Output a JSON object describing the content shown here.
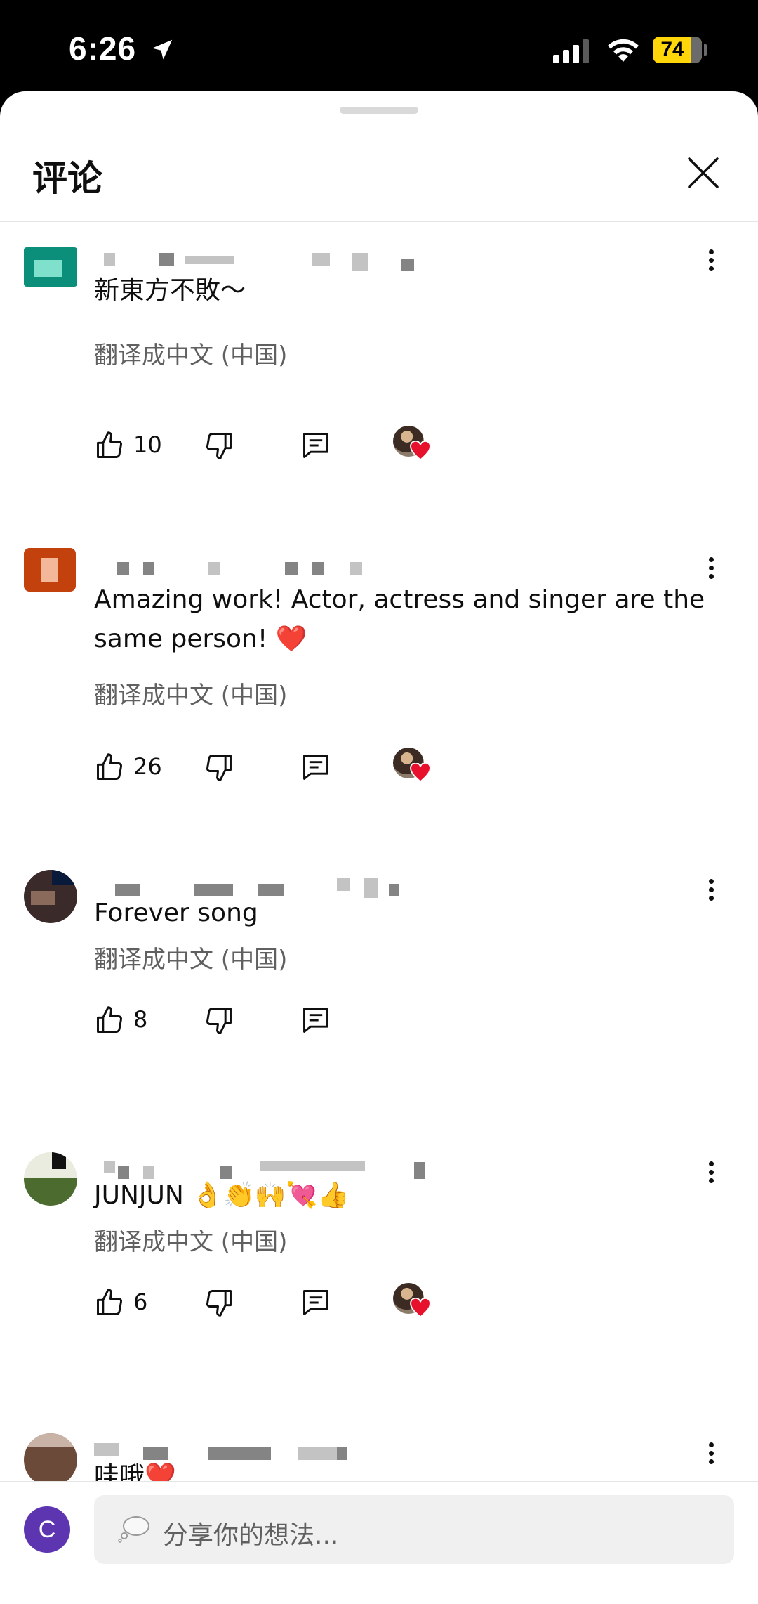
{
  "status_bar": {
    "time": "6:26",
    "battery": "74"
  },
  "sheet": {
    "title": "评论"
  },
  "comments": [
    {
      "text": "新東方不敗～",
      "translate": "翻译成中文 (中国)",
      "likes": "10",
      "creator_heart": true,
      "avatar_color": "#0b8f7a"
    },
    {
      "text": "Amazing work! Actor, actress and singer are the same person! ❤️",
      "translate": "翻译成中文 (中国)",
      "likes": "26",
      "creator_heart": true,
      "avatar_color": "#c2410c"
    },
    {
      "text": "Forever song",
      "translate": "翻译成中文 (中国)",
      "likes": "8",
      "creator_heart": false,
      "avatar_color": "#3a2a2a"
    },
    {
      "text": "JUNJUN 👌👏🙌💘👍",
      "translate": "翻译成中文 (中国)",
      "likes": "6",
      "creator_heart": true,
      "avatar_color": "#4c6b2f"
    },
    {
      "text": "哇哦❤️",
      "avatar_color": "#6b4a3a"
    }
  ],
  "composer": {
    "avatar_letter": "C",
    "placeholder": "分享你的想法..."
  },
  "colors": {
    "accent_purple": "#5e35b1",
    "heart_red": "#e8112d",
    "battery_yellow": "#ffd60a"
  }
}
